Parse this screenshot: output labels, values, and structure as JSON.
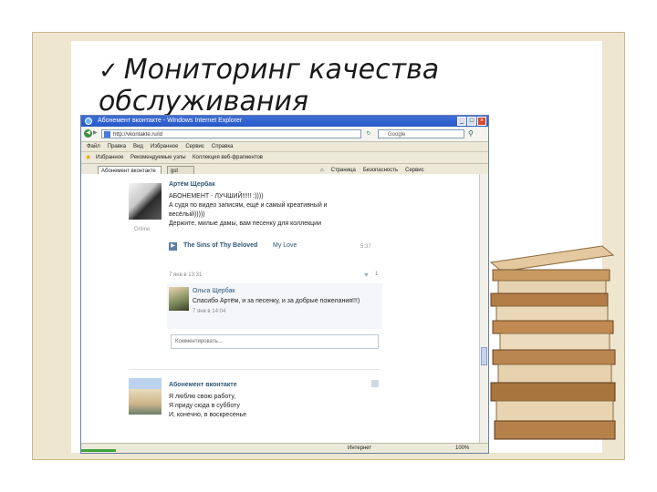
{
  "slide": {
    "check_mark": "✓",
    "title": "Мониторинг качества обслуживания"
  },
  "browser": {
    "window_title": "Абонемент вконтакте - Windows Internet Explorer",
    "address": "http://vkontakte.ru/id",
    "search_placeholder": "Google",
    "menu": [
      "Файл",
      "Правка",
      "Вид",
      "Избранное",
      "Сервис",
      "Справка"
    ],
    "favorites": [
      "Избранное",
      "Рекомендуемые узлы",
      "Коллекция веб-фрагментов"
    ],
    "tabs": [
      {
        "label": "Абонемент вконтакте"
      },
      {
        "label": "gst"
      }
    ],
    "tab_tools": [
      "Страница",
      "Безопасность",
      "Сервис"
    ],
    "status": {
      "zone": "Интернет",
      "zoom": "100%"
    }
  },
  "feed": {
    "post1": {
      "author": "Артём Щербак",
      "status": "Online",
      "lines": [
        "АБОНЕМЕНТ - ЛУЧШИЙ!!!!! :))))",
        "А судя по видео записям, ещё и самый креативный и",
        "весёлый)))))",
        "Держите, милые дамы, вам песенку для коллекции"
      ],
      "audio_artist": "The Sins of Thy Beloved",
      "audio_song": "My Love",
      "audio_duration": "5:37",
      "date": "7 янв в 13:31",
      "likes": "1"
    },
    "comment": {
      "author": "Ольга Щербак",
      "text": "Спасибо Артём, и за песенку, и за добрые пожелания!!!)",
      "date": "7 янв в 14:04",
      "input_placeholder": "Комментировать..."
    },
    "post2": {
      "author": "Абонемент вконтакте",
      "lines": [
        "Я люблю свою работу,",
        "Я приду сюда в субботу",
        "И, конечно, в воскресенье"
      ]
    }
  }
}
